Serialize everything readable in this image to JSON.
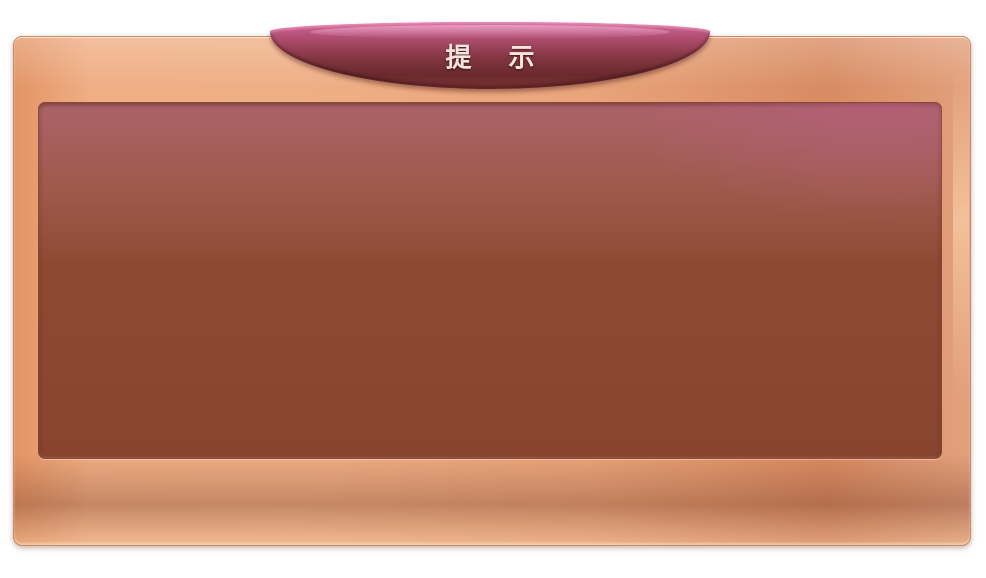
{
  "dialog": {
    "title": "提 示",
    "message": ""
  },
  "colors": {
    "frame": "#e9a47a",
    "panel": "#8d4a33",
    "title_tab": "#823640",
    "title_text": "#f4e6dc"
  }
}
